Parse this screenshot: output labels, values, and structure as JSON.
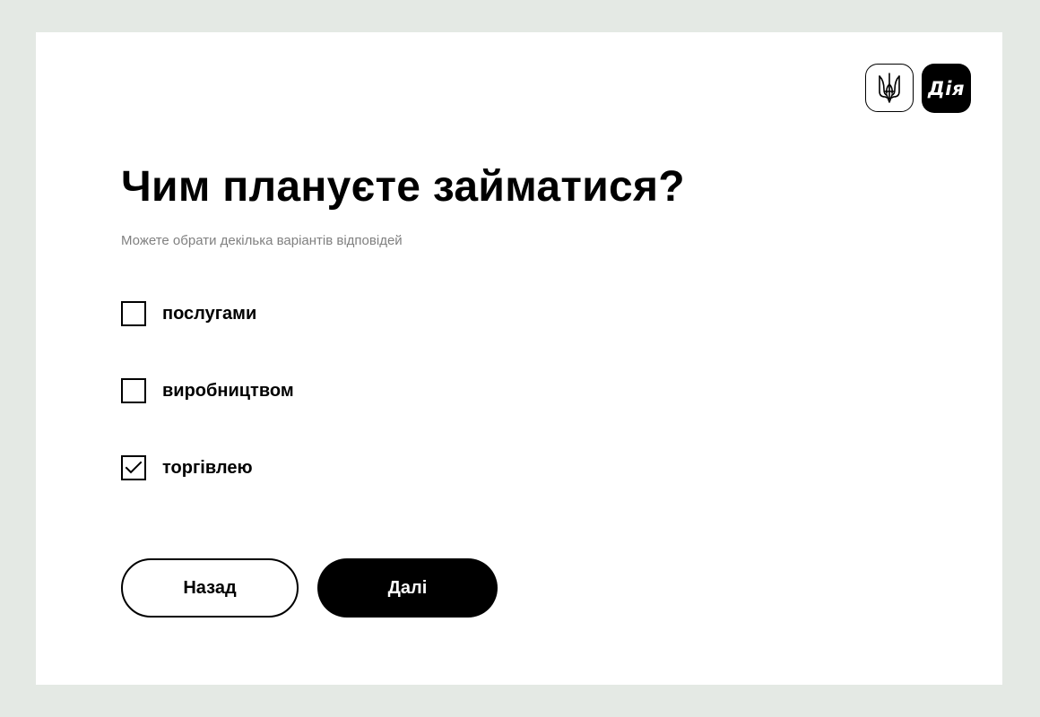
{
  "header": {
    "logo_diia": "Дія"
  },
  "question": {
    "title": "Чим плануєте займатися?",
    "subtitle": "Можете обрати декілька варіантів відповідей"
  },
  "options": [
    {
      "label": "послугами",
      "checked": false
    },
    {
      "label": "виробництвом",
      "checked": false
    },
    {
      "label": "торгівлею",
      "checked": true
    }
  ],
  "buttons": {
    "back_label": "Назад",
    "next_label": "Далі"
  },
  "colors": {
    "background": "#e4e9e4",
    "card": "#ffffff",
    "primary": "#000000",
    "muted_text": "#808080"
  }
}
